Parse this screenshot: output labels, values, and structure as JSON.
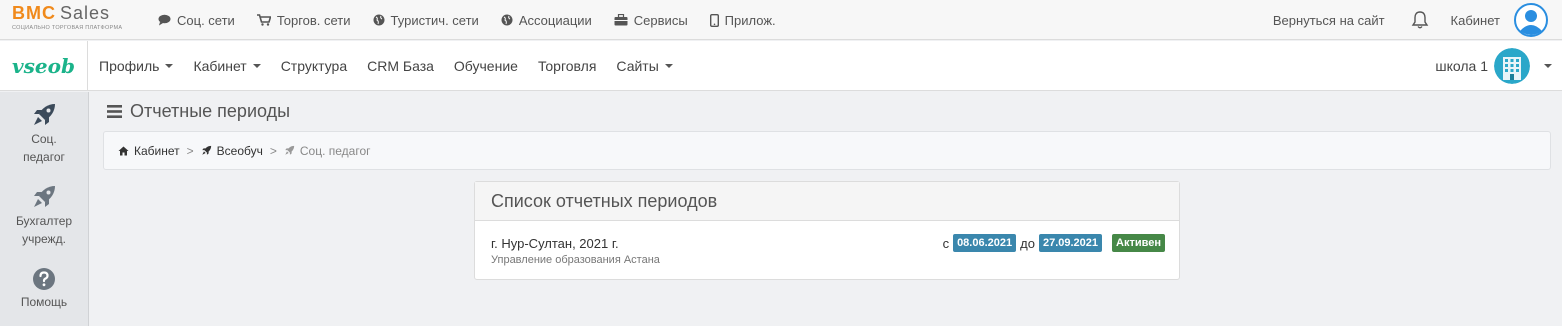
{
  "brand": {
    "logo_main": "BMC",
    "logo_second": "Sales",
    "logo_sub": "СОЦИАЛЬНО ТОРГОВАЯ ПЛАТФОРМА",
    "accent_color": "#f08a1c"
  },
  "topnav": [
    {
      "label": "Соц. сети",
      "icon": "comment-icon"
    },
    {
      "label": "Торгов. сети",
      "icon": "cart-icon"
    },
    {
      "label": "Туристич. сети",
      "icon": "globe-icon"
    },
    {
      "label": "Ассоциации",
      "icon": "globe-icon"
    },
    {
      "label": "Сервисы",
      "icon": "briefcase-icon"
    },
    {
      "label": "Прилож.",
      "icon": "mobile-icon"
    }
  ],
  "topright": {
    "back_label": "Вернуться на сайт",
    "cabinet_label": "Кабинет",
    "bell_icon": "bell-icon",
    "avatar_icon": "user-avatar-icon"
  },
  "navbar": {
    "brand": "vseob",
    "brand_color": "#1bb38a",
    "items": [
      {
        "label": "Профиль",
        "dropdown": true
      },
      {
        "label": "Кабинет",
        "dropdown": true
      },
      {
        "label": "Структура",
        "dropdown": false
      },
      {
        "label": "CRM База",
        "dropdown": false
      },
      {
        "label": "Обучение",
        "dropdown": false
      },
      {
        "label": "Торговля",
        "dropdown": false
      },
      {
        "label": "Сайты",
        "dropdown": true
      }
    ],
    "school_label": "школа 1",
    "school_icon": "building-icon"
  },
  "sidebar": {
    "items": [
      {
        "label_line1": "Соц.",
        "label_line2": "педагог",
        "icon": "rocket-icon"
      },
      {
        "label_line1": "Бухгалтер",
        "label_line2": "учрежд.",
        "icon": "rocket-icon"
      },
      {
        "label_line1": "Помощь",
        "label_line2": "",
        "icon": "question-icon"
      }
    ]
  },
  "page": {
    "title": "Отчетные периоды",
    "title_icon": "menu-icon",
    "breadcrumb": [
      {
        "label": "Кабинет",
        "icon": "home-icon"
      },
      {
        "label": "Всеобуч",
        "icon": "rocket-icon"
      },
      {
        "label": "Соц. педагог",
        "icon": "rocket-icon"
      }
    ]
  },
  "periods": {
    "heading": "Список отчетных периодов",
    "rows": [
      {
        "city": "г. Нур-Султан, 2021 г.",
        "org": "Управление образования Астана",
        "from_prefix": "с",
        "from_date": "08.06.2021",
        "to_prefix": "до",
        "to_date": "27.09.2021",
        "status": "Активен"
      }
    ]
  },
  "colors": {
    "date_badge": "#3a87ad",
    "status_badge": "#468847"
  }
}
